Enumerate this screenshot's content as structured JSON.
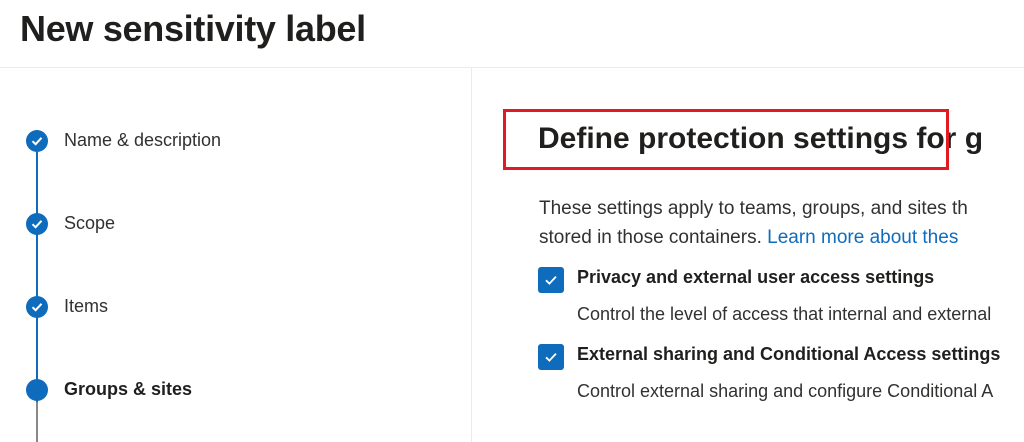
{
  "header": {
    "title": "New sensitivity label"
  },
  "wizard": {
    "steps": [
      {
        "label": "Name & description",
        "state": "completed"
      },
      {
        "label": "Scope",
        "state": "completed"
      },
      {
        "label": "Items",
        "state": "completed"
      },
      {
        "label": "Groups & sites",
        "state": "current"
      }
    ]
  },
  "main": {
    "title": "Define protection settings for g",
    "description_line1": "These settings apply to teams, groups, and sites th",
    "description_line2": "stored in those containers. ",
    "learn_more_link": "Learn more about thes",
    "options": [
      {
        "title": "Privacy and external user access settings",
        "description": "Control the level of access that internal and external",
        "checked": true
      },
      {
        "title": "External sharing and Conditional Access settings",
        "description": "Control external sharing and configure Conditional A",
        "checked": true
      }
    ]
  },
  "colors": {
    "accent": "#0f6cbd",
    "highlight": "#e11a23",
    "text": "#201f1e"
  }
}
